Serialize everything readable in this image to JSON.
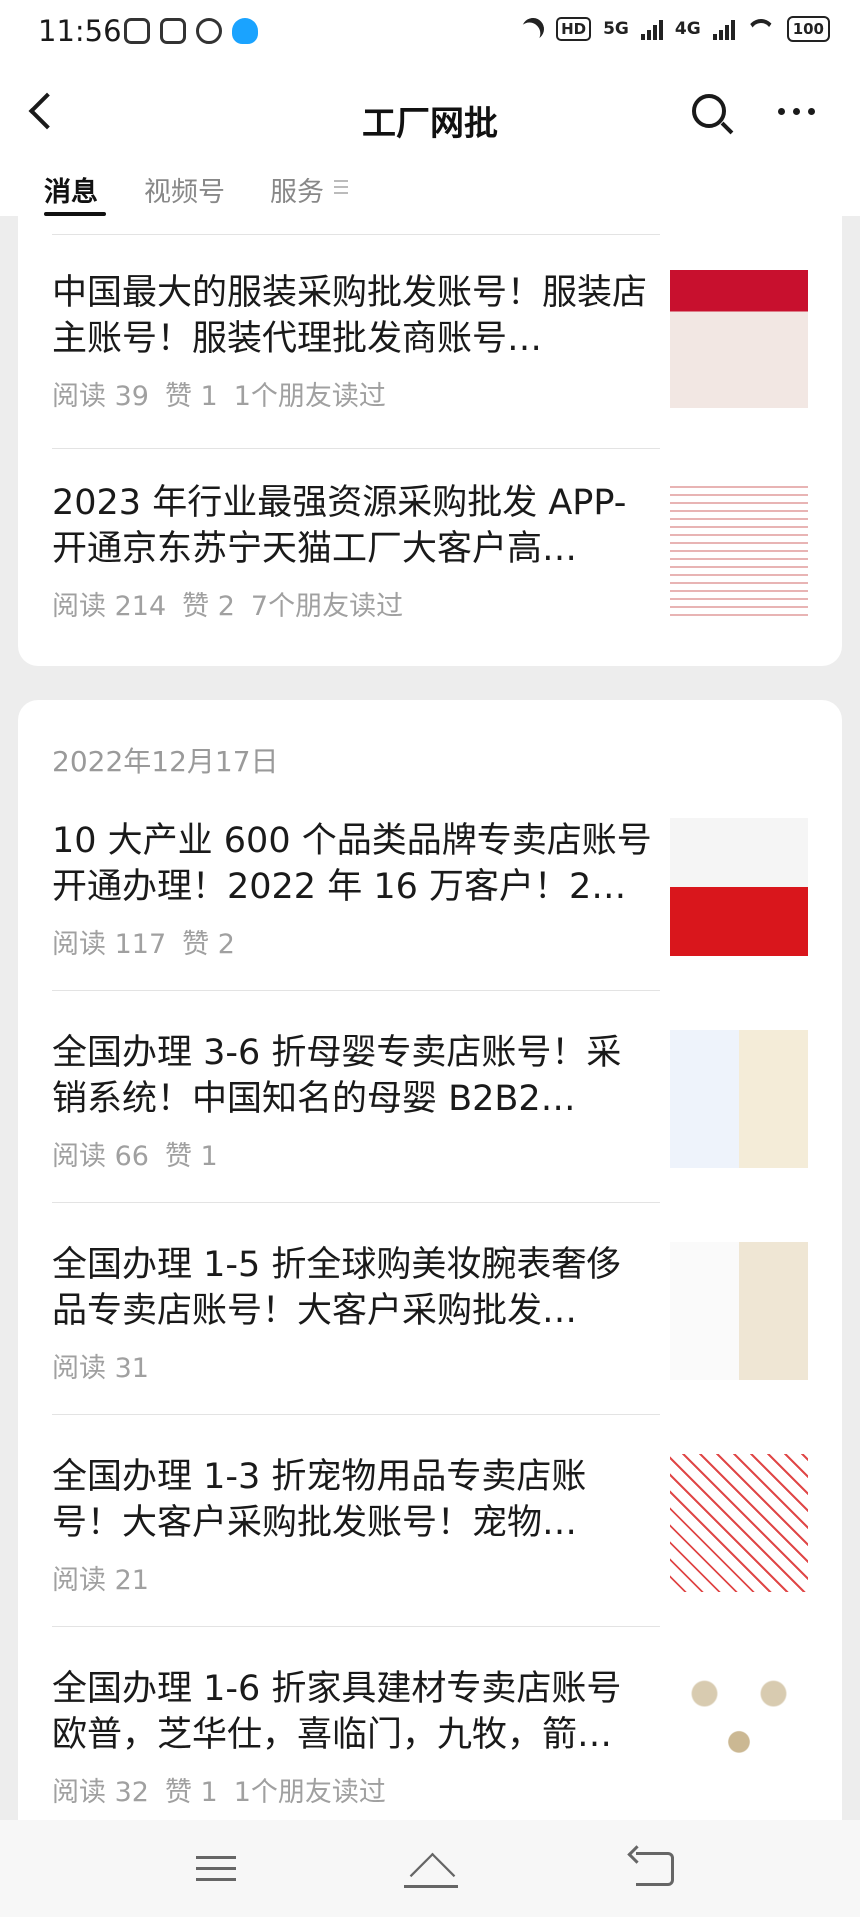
{
  "status_bar": {
    "time": "11:56",
    "signal1": "5G",
    "signal2": "4G",
    "hd": "HD",
    "battery": "100"
  },
  "nav": {
    "title": "工厂网批",
    "back_icon": "back-chevron-icon",
    "search_icon": "search-icon",
    "more_icon": "more-dots-icon"
  },
  "tabs": [
    {
      "label": "消息",
      "active": true
    },
    {
      "label": "视频号",
      "active": false
    },
    {
      "label": "服务",
      "active": false
    }
  ],
  "groups": [
    {
      "date": "",
      "articles": [
        {
          "title": "中国最大的服装采购批发账号！服装店主账号！服装代理批发商账号…",
          "reads": "阅读 39",
          "likes": "赞 1",
          "friends": "1个朋友读过",
          "thumb_colors": [
            "#c8102e",
            "#f2e7e3"
          ]
        },
        {
          "title": "2023 年行业最强资源采购批发 APP-开通京东苏宁天猫工厂大客户高…",
          "reads": "阅读 214",
          "likes": "赞 2",
          "friends": "7个朋友读过",
          "thumb_colors": [
            "#ffffff",
            "#d23a3a"
          ]
        }
      ]
    },
    {
      "date": "2022年12月17日",
      "articles": [
        {
          "title": "10 大产业 600 个品类品牌专卖店账号开通办理！2022 年 16 万客户！2…",
          "reads": "阅读 117",
          "likes": "赞 2",
          "friends": "",
          "thumb_colors": [
            "#f5f5f5",
            "#d9161c"
          ]
        },
        {
          "title": "全国办理 3-6 折母婴专卖店账号！采销系统！中国知名的母婴 B2B2…",
          "reads": "阅读 66",
          "likes": "赞 1",
          "friends": "",
          "thumb_colors": [
            "#ffffff",
            "#c9a86a"
          ]
        },
        {
          "title": "全国办理 1-5 折全球购美妆腕表奢侈品专卖店账号！大客户采购批发…",
          "reads": "阅读 31",
          "likes": "",
          "friends": "",
          "thumb_colors": [
            "#fafafa",
            "#d8c9a8"
          ]
        },
        {
          "title": "全国办理 1-3 折宠物用品专卖店账号！大客户采购批发账号！宠物…",
          "reads": "阅读 21",
          "likes": "",
          "friends": "",
          "thumb_colors": [
            "#ffffff",
            "#d62828"
          ]
        },
        {
          "title": "全国办理 1-6 折家具建材专卖店账号欧普，芝华仕，喜临门，九牧，箭…",
          "reads": "阅读 32",
          "likes": "赞 1",
          "friends": "1个朋友读过",
          "thumb_colors": [
            "#ffffff",
            "#bfae8e"
          ]
        }
      ]
    }
  ],
  "system_nav": [
    "menu-icon",
    "home-icon",
    "back-icon"
  ]
}
